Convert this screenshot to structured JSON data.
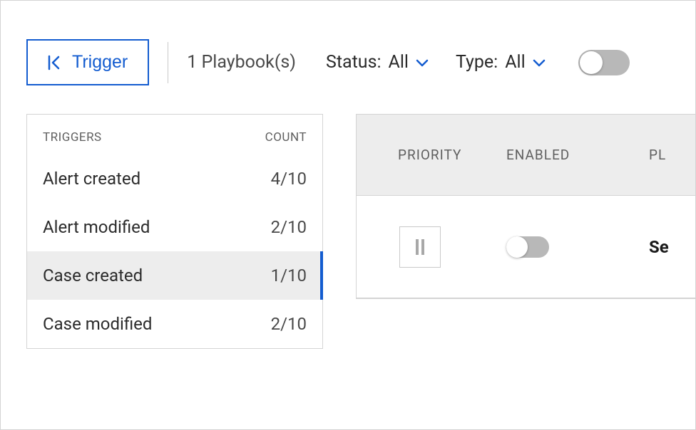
{
  "toolbar": {
    "trigger_button_label": "Trigger",
    "playbook_count_text": "1 Playbook(s)",
    "status_filter": {
      "label": "Status:",
      "value": "All"
    },
    "type_filter": {
      "label": "Type:",
      "value": "All"
    },
    "main_toggle_on": false
  },
  "triggers_panel": {
    "header_triggers": "TRIGGERS",
    "header_count": "COUNT",
    "rows": [
      {
        "name": "Alert created",
        "count": "4/10",
        "selected": false
      },
      {
        "name": "Alert modified",
        "count": "2/10",
        "selected": false
      },
      {
        "name": "Case created",
        "count": "1/10",
        "selected": true
      },
      {
        "name": "Case modified",
        "count": "2/10",
        "selected": false
      }
    ]
  },
  "table": {
    "columns": {
      "priority": "PRIORITY",
      "enabled": "ENABLED",
      "third_visible": "PL"
    },
    "rows": [
      {
        "enabled": false,
        "name_fragment": "Se"
      }
    ]
  }
}
